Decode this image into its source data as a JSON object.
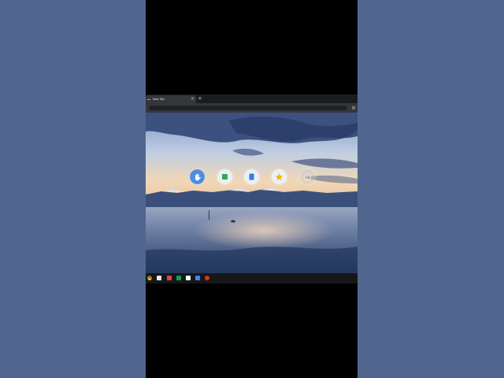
{
  "browser": {
    "tab": {
      "title": "New Tab",
      "close_glyph": "×"
    },
    "new_tab_glyph": "+",
    "toolbar": {
      "menu_icon": "circle-icon"
    }
  },
  "new_tab_page": {
    "shortcuts": [
      {
        "name": "blue-hand-icon",
        "color": "#4e8ee0"
      },
      {
        "name": "green-square-icon",
        "color": "#34a853"
      },
      {
        "name": "blue-bookmark-icon",
        "color": "#3b78e7"
      },
      {
        "name": "gold-star-icon",
        "color": "#f4b400"
      },
      {
        "name": "add-shortcut-icon",
        "color": "#cccccc"
      }
    ]
  },
  "taskbar": {
    "icons": [
      {
        "name": "chrome-icon",
        "color": "#34a853"
      },
      {
        "name": "files-icon",
        "color": "#e8eaed"
      },
      {
        "name": "gmail-icon",
        "color": "#ea4335"
      },
      {
        "name": "sheets-icon",
        "color": "#0f9d58"
      },
      {
        "name": "docs-icon",
        "color": "#ffffff"
      },
      {
        "name": "play-store-icon",
        "color": "#4285f4"
      },
      {
        "name": "app-icon",
        "color": "#d93025"
      }
    ]
  },
  "colors": {
    "side_background": "#50668f",
    "video_background": "#000000"
  }
}
